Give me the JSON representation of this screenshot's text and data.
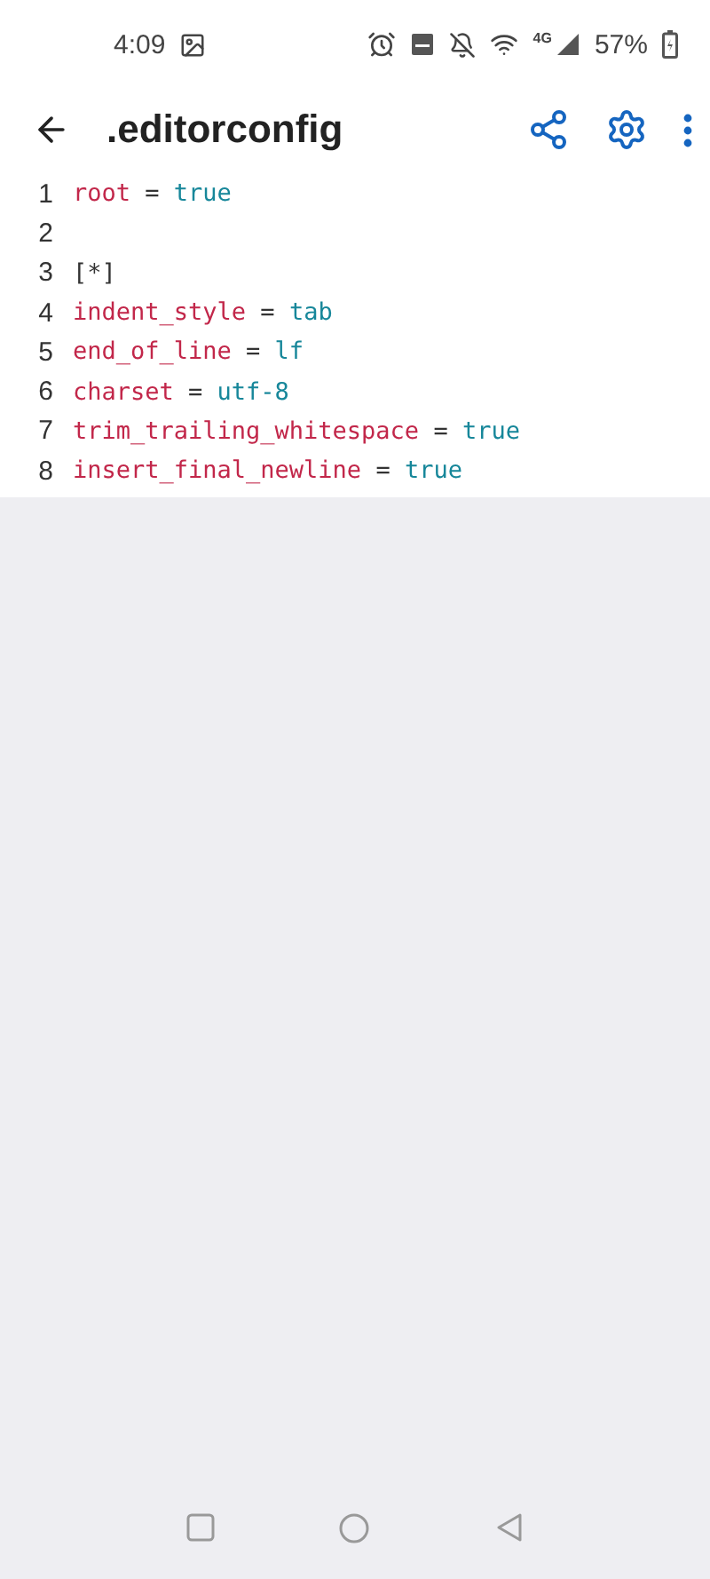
{
  "status_bar": {
    "time": "4:09",
    "battery": "57%",
    "network": "4G"
  },
  "toolbar": {
    "title": ".editorconfig"
  },
  "editor": {
    "lines": [
      {
        "number": "1",
        "tokens": [
          {
            "kind": "key",
            "text": "root"
          },
          {
            "kind": "op",
            "text": " = "
          },
          {
            "kind": "value",
            "text": "true"
          }
        ]
      },
      {
        "number": "2"
      },
      {
        "number": "3",
        "tokens": [
          {
            "kind": "section",
            "text": "[*]"
          }
        ]
      },
      {
        "number": "4",
        "tokens": [
          {
            "kind": "key",
            "text": "indent_style"
          },
          {
            "kind": "op",
            "text": " = "
          },
          {
            "kind": "value",
            "text": "tab"
          }
        ]
      },
      {
        "number": "5",
        "tokens": [
          {
            "kind": "key",
            "text": "end_of_line"
          },
          {
            "kind": "op",
            "text": " = "
          },
          {
            "kind": "value",
            "text": "lf"
          }
        ]
      },
      {
        "number": "6",
        "tokens": [
          {
            "kind": "key",
            "text": "charset"
          },
          {
            "kind": "op",
            "text": " = "
          },
          {
            "kind": "value",
            "text": "utf-8"
          }
        ]
      },
      {
        "number": "7",
        "tokens": [
          {
            "kind": "key",
            "text": "trim_trailing_whitespace"
          },
          {
            "kind": "op",
            "text": " = "
          },
          {
            "kind": "value",
            "text": "true"
          }
        ]
      },
      {
        "number": "8",
        "tokens": [
          {
            "kind": "key",
            "text": "insert_final_newline"
          },
          {
            "kind": "op",
            "text": " = "
          },
          {
            "kind": "value",
            "text": "true"
          }
        ]
      }
    ]
  }
}
